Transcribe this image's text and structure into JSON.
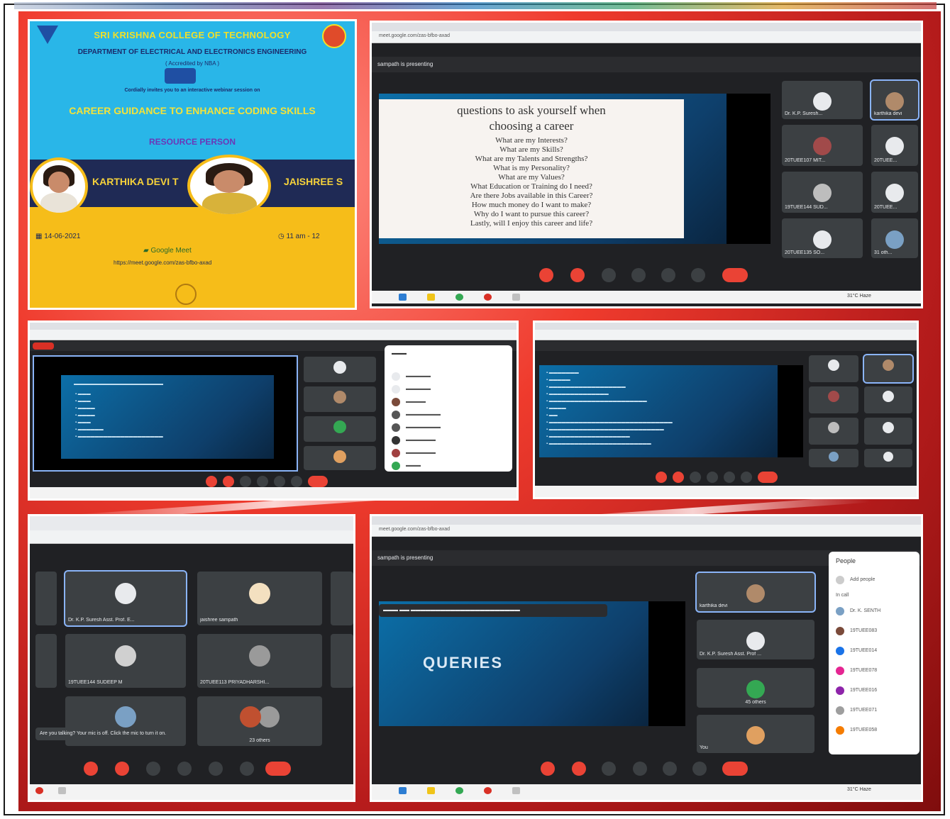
{
  "poster": {
    "college": "SRI KRISHNA COLLEGE OF TECHNOLOGY",
    "department": "DEPARTMENT OF ELECTRICAL AND ELECTRONICS ENGINEERING",
    "accreditation": "( Accredited by NBA )",
    "invitation": "Cordially invites you to an interactive webinar session on",
    "title": "CAREER GUIDANCE  TO ENHANCE CODING SKILLS",
    "resource_person_label": "RESOURCE PERSON",
    "speaker1": "KARTHIKA DEVI T",
    "speaker2": "JAISHREE S",
    "date": "14-06-2021",
    "time": "11 am - 12",
    "platform": "Google Meet",
    "link": "https://meet.google.com/zas-bfbo-axad"
  },
  "window_top_right": {
    "url": "meet.google.com/zas-bfbo-axad",
    "presenting": "sampath is presenting",
    "slide_title_1": "questions to ask yourself when",
    "slide_title_2": "choosing a career",
    "slide_lines": [
      "What are my Interests?",
      "What are my Skills?",
      "What are my Talents and Strengths?",
      "What is my Personality?",
      "What are my Values?",
      "What Education or Training do I need?",
      "Are there Jobs available in this Career?",
      "How much money do I want to make?",
      "Why do I want to pursue this career?",
      "Lastly, will I enjoy this career and life?"
    ],
    "tiles": [
      {
        "label": "Dr. K.P. Suresh..."
      },
      {
        "label": "karthika devi"
      },
      {
        "label": "20TUEE107 MIT..."
      },
      {
        "label": "20TUEE..."
      },
      {
        "label": "19TUEE144 SUD..."
      },
      {
        "label": "20TUEE..."
      },
      {
        "label": "20TUEE135 SO..."
      },
      {
        "label": "31 oth..."
      }
    ],
    "weather": "31°C Haze"
  },
  "window_bottom_right": {
    "url": "meet.google.com/zas-bfbo-axad",
    "presenting": "sampath is presenting",
    "slide_word": "QUERIES",
    "tiles": [
      {
        "label": "karthika devi"
      },
      {
        "label": "Dr. K.P. Suresh Asst. Prof ..."
      },
      {
        "label": "45 others"
      },
      {
        "label": "You"
      }
    ],
    "people_title": "People",
    "add_people": "Add people",
    "in_call": "In call",
    "people": [
      "Dr. K. SENTH",
      "19TUEE083",
      "19TUEE014",
      "19TUEE078",
      "19TUEE016",
      "19TUEE071",
      "19TUEE058"
    ],
    "weather": "31°C Haze"
  },
  "window_bottom_left": {
    "tiles": [
      {
        "label": "Dr. K.P. Suresh Asst. Prof. E..."
      },
      {
        "label": "jaishree sampath"
      },
      {
        "label": "19TUEE144 SUDEEP M"
      },
      {
        "label": "20TUEE113 PRIYADHARSHI..."
      },
      {
        "label": ""
      },
      {
        "label": "23 others"
      }
    ],
    "toast": "Are you talking? Your mic is off. Click the mic to turn it on."
  }
}
